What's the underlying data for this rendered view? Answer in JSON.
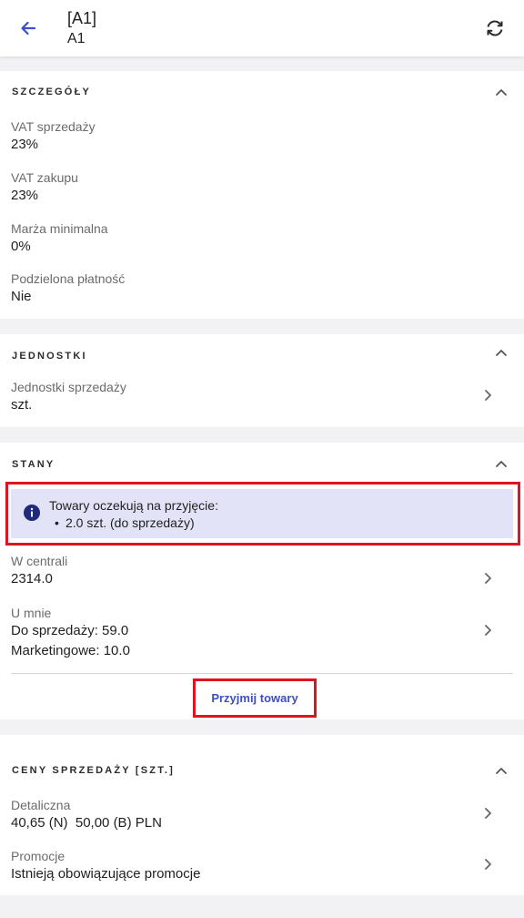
{
  "header": {
    "title": "[A1]",
    "subtitle": "A1",
    "back_icon": "arrow-left-icon",
    "sync_icon": "sync-icon",
    "accent_color": "#3d4fc4"
  },
  "details": {
    "title": "SZCZEGÓŁY",
    "fields": [
      {
        "label": "VAT sprzedaży",
        "value": "23%"
      },
      {
        "label": "VAT zakupu",
        "value": "23%"
      },
      {
        "label": "Marża minimalna",
        "value": "0%"
      },
      {
        "label": "Podzielona płatność",
        "value": "Nie"
      }
    ]
  },
  "units": {
    "title": "JEDNOSTKI",
    "label": "Jednostki sprzedaży",
    "value": "szt."
  },
  "stock": {
    "title": "STANY",
    "notice_title": "Towary oczekują na przyjęcie:",
    "notice_bullet": "•",
    "notice_item": "2.0 szt. (do sprzedaży)",
    "hq_label": "W centrali",
    "hq_value": "2314.0",
    "mine_label": "U mnie",
    "mine_sale": "Do sprzedaży: 59.0",
    "mine_marketing": "Marketingowe: 10.0",
    "accept_button": "Przyjmij towary",
    "highlight_color": "#e0141e"
  },
  "prices": {
    "title": "CENY SPRZEDAŻY [SZT.]",
    "retail_label": "Detaliczna",
    "retail_value": "40,65 (N)  50,00 (B) PLN",
    "promo_label": "Promocje",
    "promo_value": "Istnieją obowiązujące promocje"
  }
}
